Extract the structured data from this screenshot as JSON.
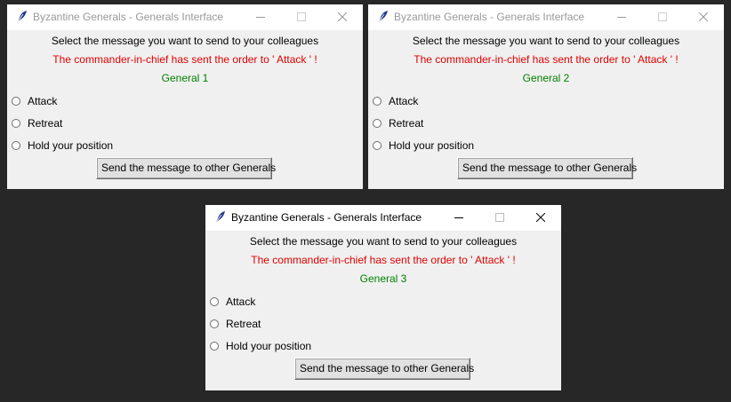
{
  "windows": [
    {
      "title": "Byzantine Generals - Generals Interface",
      "active": false,
      "instruction": "Select the message you want to send to your colleagues",
      "order_text": "The commander-in-chief has sent the order to ' Attack ' !",
      "general_label": "General 1",
      "options": [
        {
          "label": "Attack",
          "selected": false
        },
        {
          "label": "Retreat",
          "selected": false
        },
        {
          "label": "Hold your position",
          "selected": false
        }
      ],
      "send_button_label": "Send the message to other Generals"
    },
    {
      "title": "Byzantine Generals - Generals Interface",
      "active": false,
      "instruction": "Select the message you want to send to your colleagues",
      "order_text": "The commander-in-chief has sent the order to ' Attack ' !",
      "general_label": "General 2",
      "options": [
        {
          "label": "Attack",
          "selected": false
        },
        {
          "label": "Retreat",
          "selected": false
        },
        {
          "label": "Hold your position",
          "selected": false
        }
      ],
      "send_button_label": "Send the message to other Generals"
    },
    {
      "title": "Byzantine Generals - Generals Interface",
      "active": true,
      "instruction": "Select the message you want to send to your colleagues",
      "order_text": "The commander-in-chief has sent the order to ' Attack ' !",
      "general_label": "General 3",
      "options": [
        {
          "label": "Attack",
          "selected": false
        },
        {
          "label": "Retreat",
          "selected": false
        },
        {
          "label": "Hold your position",
          "selected": false
        }
      ],
      "send_button_label": "Send the message to other Generals"
    }
  ],
  "icons": {
    "app": "feather-icon",
    "minimize": "minimize-icon",
    "maximize": "maximize-icon",
    "close": "close-icon"
  },
  "colors": {
    "desktop": "#272727",
    "window_bg": "#f0f0f0",
    "order_text": "#e00000",
    "general_text": "#008000",
    "inactive_title": "#999999"
  }
}
